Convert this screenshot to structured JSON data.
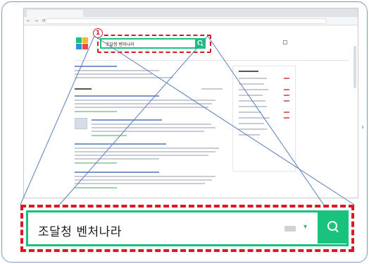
{
  "browser": {
    "tab_title": "",
    "address": "",
    "nav_icons": "← → ⟳ ⌂"
  },
  "header": {
    "badge": "1",
    "search_query": "조달청 벤처나라",
    "login_label": "",
    "gnb_items": [
      "",
      "",
      "",
      "",
      "",
      "",
      "",
      "",
      ""
    ],
    "gnb_right": ""
  },
  "zoom": {
    "search_query": "조달청 벤처나라"
  },
  "colors": {
    "brand_green": "#19c37d",
    "highlight_red": "#d9192a",
    "frame_blue": "#7a9cc6"
  },
  "icons": {
    "search": "search-icon",
    "keyboard": "keyboard-icon",
    "dropdown": "chevron-down-icon"
  }
}
